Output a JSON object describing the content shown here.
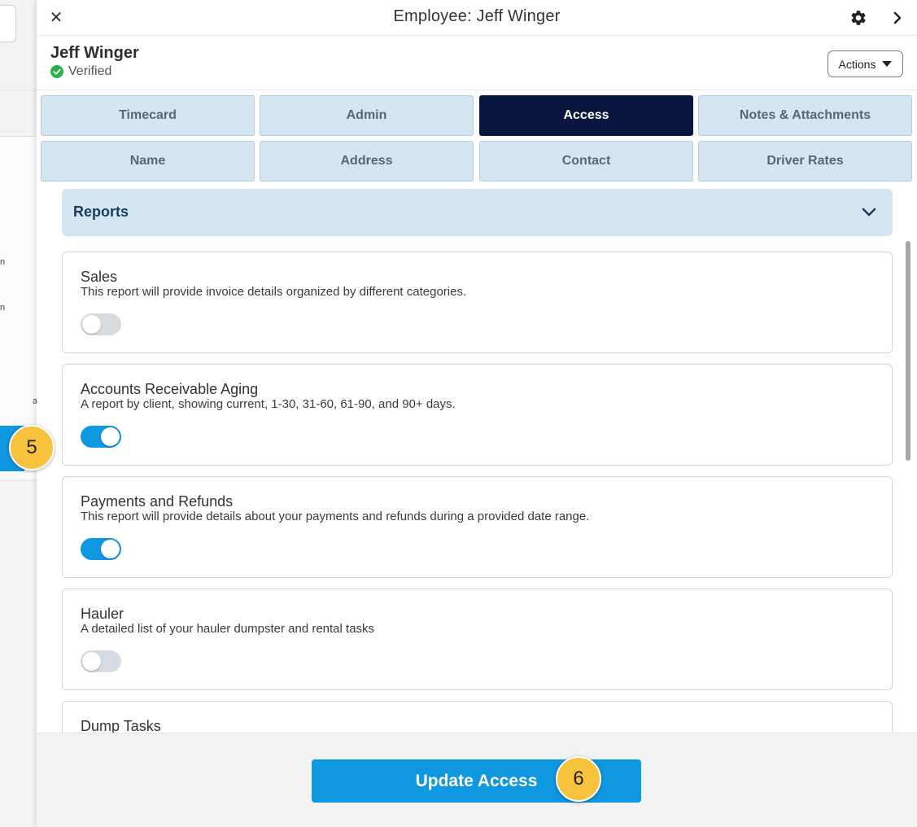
{
  "window": {
    "title": "Employee: Jeff Winger"
  },
  "employee": {
    "name": "Jeff Winger",
    "status": "Verified"
  },
  "actions": {
    "label": "Actions"
  },
  "tabs": [
    {
      "label": "Timecard",
      "active": false
    },
    {
      "label": "Admin",
      "active": false
    },
    {
      "label": "Access",
      "active": true
    },
    {
      "label": "Notes & Attachments",
      "active": false
    },
    {
      "label": "Name",
      "active": false
    },
    {
      "label": "Address",
      "active": false
    },
    {
      "label": "Contact",
      "active": false
    },
    {
      "label": "Driver Rates",
      "active": false
    }
  ],
  "section": {
    "title": "Reports",
    "expanded": true
  },
  "reports": [
    {
      "title": "Sales",
      "description": "This report will provide invoice details organized by different categories.",
      "enabled": false
    },
    {
      "title": "Accounts Receivable Aging",
      "description": "A report by client, showing current, 1-30, 31-60, 61-90, and 90+ days.",
      "enabled": true
    },
    {
      "title": "Payments and Refunds",
      "description": "This report will provide details about your payments and refunds during a provided date range.",
      "enabled": true
    },
    {
      "title": "Hauler",
      "description": "A detailed list of your hauler dumpster and rental tasks",
      "enabled": false
    },
    {
      "title": "Dump Tasks",
      "description": "",
      "enabled": false
    }
  ],
  "footer": {
    "button_label": "Update Access"
  },
  "annotations": {
    "step5": "5",
    "step6": "6"
  },
  "background": {
    "fragments": [
      "n",
      "n",
      "a"
    ]
  },
  "colors": {
    "accent": "#0f97e0",
    "active_tab": "#08153f",
    "tab_bg": "#d5e6f3",
    "badge": "#f8c33c",
    "verified": "#2bb24c"
  }
}
